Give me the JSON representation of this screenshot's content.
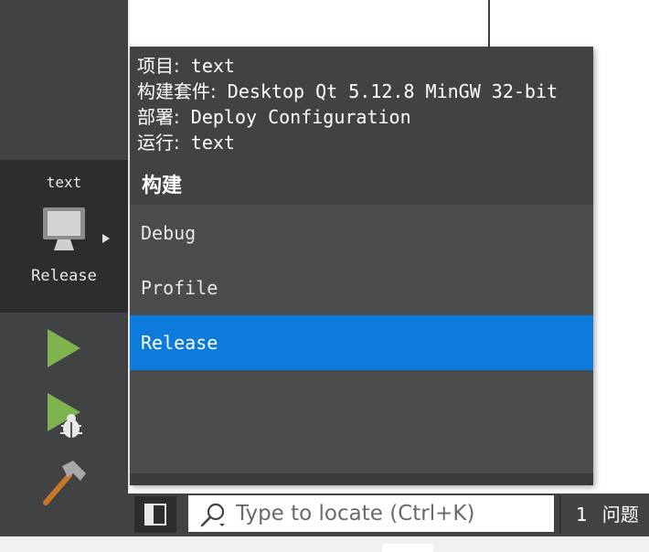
{
  "kit_popup": {
    "project_label": "项目:",
    "project_value": "text",
    "kit_label": "构建套件:",
    "kit_value": "Desktop Qt 5.12.8 MinGW 32-bit",
    "deploy_label": "部署:",
    "deploy_value": "Deploy Configuration",
    "run_label": "运行:",
    "run_value": "text",
    "section_title": "构建",
    "build_items": [
      {
        "label": "Debug",
        "selected": false
      },
      {
        "label": "Profile",
        "selected": false
      },
      {
        "label": "Release",
        "selected": true
      }
    ]
  },
  "sidebar": {
    "target_project": "text",
    "target_build": "Release",
    "icons": [
      "monitor-icon",
      "run-icon",
      "debug-run-icon",
      "build-hammer-icon"
    ]
  },
  "statusbar": {
    "locator_placeholder": "Type to locate (Ctrl+K)",
    "issues_count": "1",
    "issues_label": "问题"
  },
  "colors": {
    "selected": "#0c7bdc",
    "run_green": "#7fb34e",
    "sidebar": "#404244",
    "popup": "#4a4b4d"
  }
}
